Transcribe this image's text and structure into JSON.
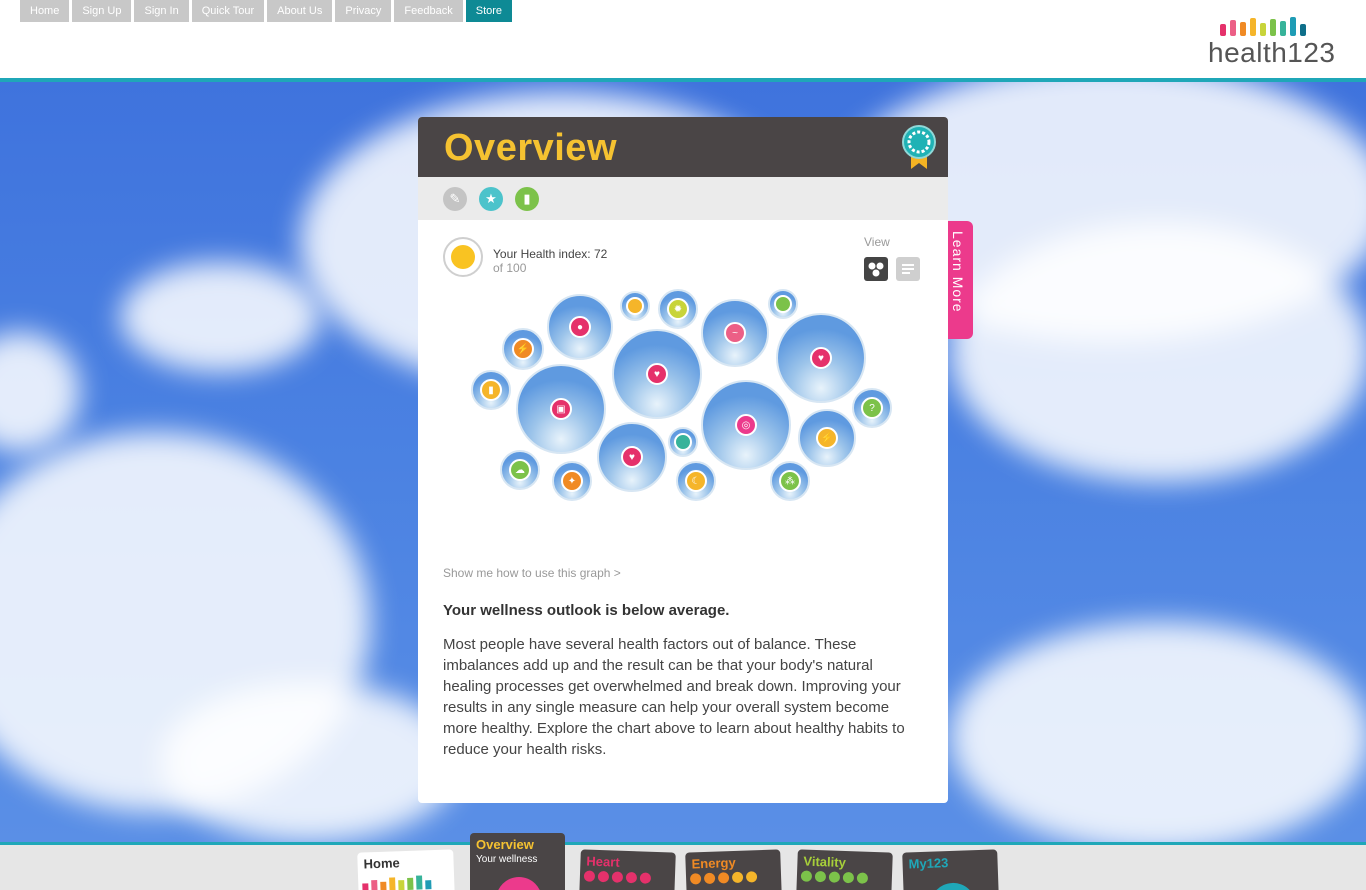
{
  "nav": {
    "items": [
      {
        "label": "Home"
      },
      {
        "label": "Sign Up"
      },
      {
        "label": "Sign In"
      },
      {
        "label": "Quick Tour"
      },
      {
        "label": "About Us"
      },
      {
        "label": "Privacy"
      },
      {
        "label": "Feedback"
      },
      {
        "label": "Store",
        "active": true
      }
    ]
  },
  "logo": {
    "text": "health123",
    "bar_colors": [
      "#e5316b",
      "#ec5f86",
      "#f08a24",
      "#f5b52a",
      "#c8d43a",
      "#7cc24a",
      "#37b39a",
      "#1f9cb5",
      "#0e6f8a"
    ]
  },
  "card": {
    "title": "Overview",
    "toolbar_icons": [
      "tools-icon",
      "star-icon",
      "bar-chart-icon"
    ],
    "health_index_label": "Your Health index: 72",
    "health_index_sub": "of 100",
    "view_label": "View",
    "howto_link": "Show me how to use this graph >",
    "outlook_heading": "Your wellness outlook is below average.",
    "description": "Most people have several health factors out of balance. These imbalances add up and the result can be that your body's natural healing processes get overwhelmed and break down. Improving your results in any single measure can help your overall system become more healthy. Explore the chart above to learn about healthy habits to reduce your health risks."
  },
  "learn_more": {
    "label": "Learn More"
  },
  "dock": {
    "tiles": [
      {
        "title": "Home",
        "sub": ""
      },
      {
        "title": "Overview",
        "sub": "Your wellness"
      },
      {
        "title": "Heart",
        "sub": ""
      },
      {
        "title": "Energy",
        "sub": ""
      },
      {
        "title": "Vitality",
        "sub": ""
      },
      {
        "title": "My123",
        "sub": ""
      }
    ]
  },
  "colors": {
    "accent_teal": "#1fa7b8",
    "title_yellow": "#f5c231",
    "header_dark": "#4a4546",
    "learn_pink": "#ec3a8c"
  }
}
